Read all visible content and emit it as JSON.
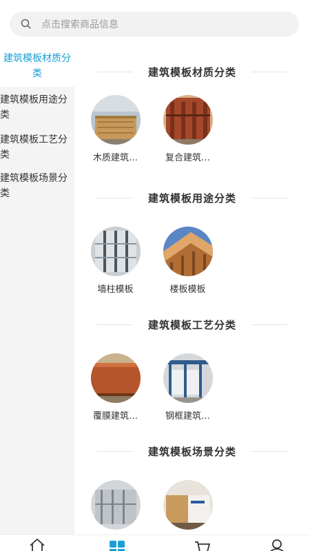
{
  "search": {
    "placeholder": "点击搜索商品信息",
    "icon": "search-icon"
  },
  "sidebar": {
    "items": [
      {
        "label": "建筑模板材质分类",
        "active": true
      },
      {
        "label": "建筑模板用途分类",
        "active": false
      },
      {
        "label": "建筑模板工艺分类",
        "active": false
      },
      {
        "label": "建筑模板场景分类",
        "active": false
      }
    ]
  },
  "sections": [
    {
      "title": "建筑模板材质分类",
      "products": [
        "木质建筑…",
        "复合建筑…"
      ]
    },
    {
      "title": "建筑模板用途分类",
      "products": [
        "墙柱模板",
        "楼板模板"
      ]
    },
    {
      "title": "建筑模板工艺分类",
      "products": [
        "覆膜建筑…",
        "钢框建筑…"
      ]
    },
    {
      "title": "建筑模板场景分类",
      "products": [
        "",
        ""
      ]
    }
  ],
  "tabbar": {
    "tabs": [
      {
        "icon": "home-icon"
      },
      {
        "icon": "category-icon",
        "active": true
      },
      {
        "icon": "cart-icon"
      },
      {
        "icon": "user-icon"
      }
    ],
    "active_color": "#1a9fd8"
  },
  "colors": {
    "accent": "#1a9fd8"
  }
}
